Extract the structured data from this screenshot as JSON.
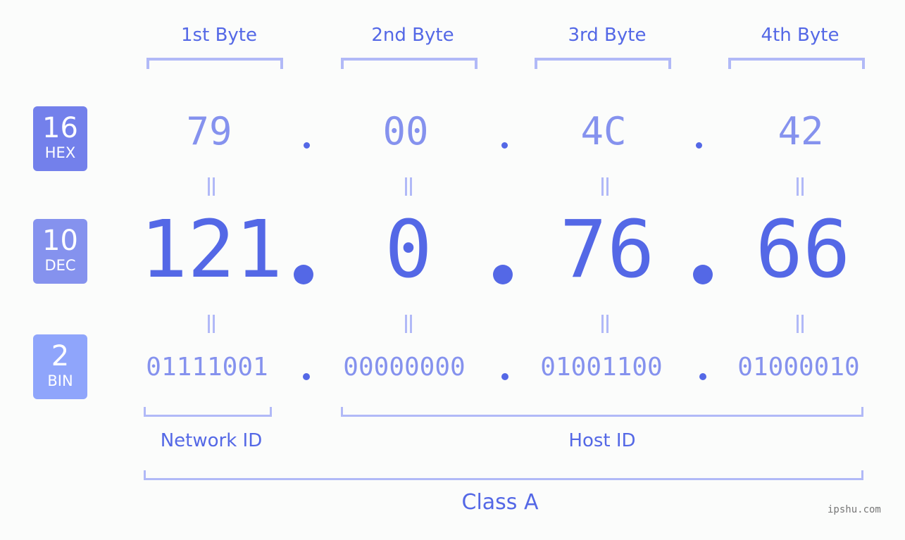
{
  "badges": [
    {
      "num": "16",
      "label": "HEX",
      "color": "#7380eb"
    },
    {
      "num": "10",
      "label": "DEC",
      "color": "#8592ee"
    },
    {
      "num": "2",
      "label": "BIN",
      "color": "#8fa5fb"
    }
  ],
  "bytes": [
    {
      "header": "1st Byte",
      "hex": "79",
      "dec": "121",
      "bin": "01111001"
    },
    {
      "header": "2nd Byte",
      "hex": "00",
      "dec": "0",
      "bin": "00000000"
    },
    {
      "header": "3rd Byte",
      "hex": "4C",
      "dec": "76",
      "bin": "01001100"
    },
    {
      "header": "4th Byte",
      "hex": "42",
      "dec": "66",
      "bin": "01000010"
    }
  ],
  "ranges": {
    "network": "Network ID",
    "host": "Host ID",
    "class": "Class A"
  },
  "watermark": "ipshu.com",
  "colors": {
    "primary": "#5468e6",
    "secondary": "#8592ee",
    "bracket": "#b1b9f7",
    "background": "#fbfcfb"
  }
}
